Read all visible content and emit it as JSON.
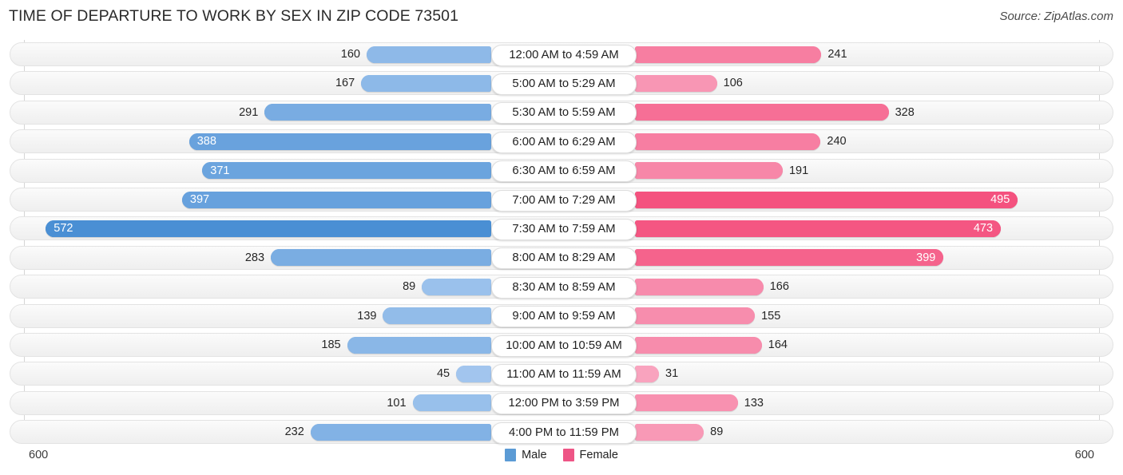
{
  "header": {
    "title": "TIME OF DEPARTURE TO WORK BY SEX IN ZIP CODE 73501",
    "source": "Source: ZipAtlas.com"
  },
  "axis": {
    "left_max": "600",
    "right_max": "600"
  },
  "legend": {
    "items": [
      {
        "label": "Male",
        "color": "#5b9bd5"
      },
      {
        "label": "Female",
        "color": "#ee5586"
      }
    ]
  },
  "colors": {
    "male_light": "#a9caf0",
    "male_dark": "#4a8fd4",
    "female_light": "#f9a8c2",
    "female_dark": "#f4527f",
    "track": "#f4f4f4",
    "track_border": "#e3e3e3",
    "axis_line": "#d5d5d5",
    "title": "#2b2b2b"
  },
  "chart_data": {
    "type": "bar",
    "orientation": "horizontal-diverging",
    "title": "TIME OF DEPARTURE TO WORK BY SEX IN ZIP CODE 73501",
    "xlabel": "",
    "ylabel": "",
    "xlim": [
      600,
      600
    ],
    "grid": false,
    "legend_position": "bottom-center",
    "categories": [
      "12:00 AM to 4:59 AM",
      "5:00 AM to 5:29 AM",
      "5:30 AM to 5:59 AM",
      "6:00 AM to 6:29 AM",
      "6:30 AM to 6:59 AM",
      "7:00 AM to 7:29 AM",
      "7:30 AM to 7:59 AM",
      "8:00 AM to 8:29 AM",
      "8:30 AM to 8:59 AM",
      "9:00 AM to 9:59 AM",
      "10:00 AM to 10:59 AM",
      "11:00 AM to 11:59 AM",
      "12:00 PM to 3:59 PM",
      "4:00 PM to 11:59 PM"
    ],
    "series": [
      {
        "name": "Male",
        "color": "#5b9bd5",
        "values": [
          160,
          167,
          291,
          388,
          371,
          397,
          572,
          283,
          89,
          139,
          185,
          45,
          101,
          232
        ]
      },
      {
        "name": "Female",
        "color": "#ee5586",
        "values": [
          241,
          106,
          328,
          240,
          191,
          495,
          473,
          399,
          166,
          155,
          164,
          31,
          133,
          89
        ]
      }
    ]
  }
}
